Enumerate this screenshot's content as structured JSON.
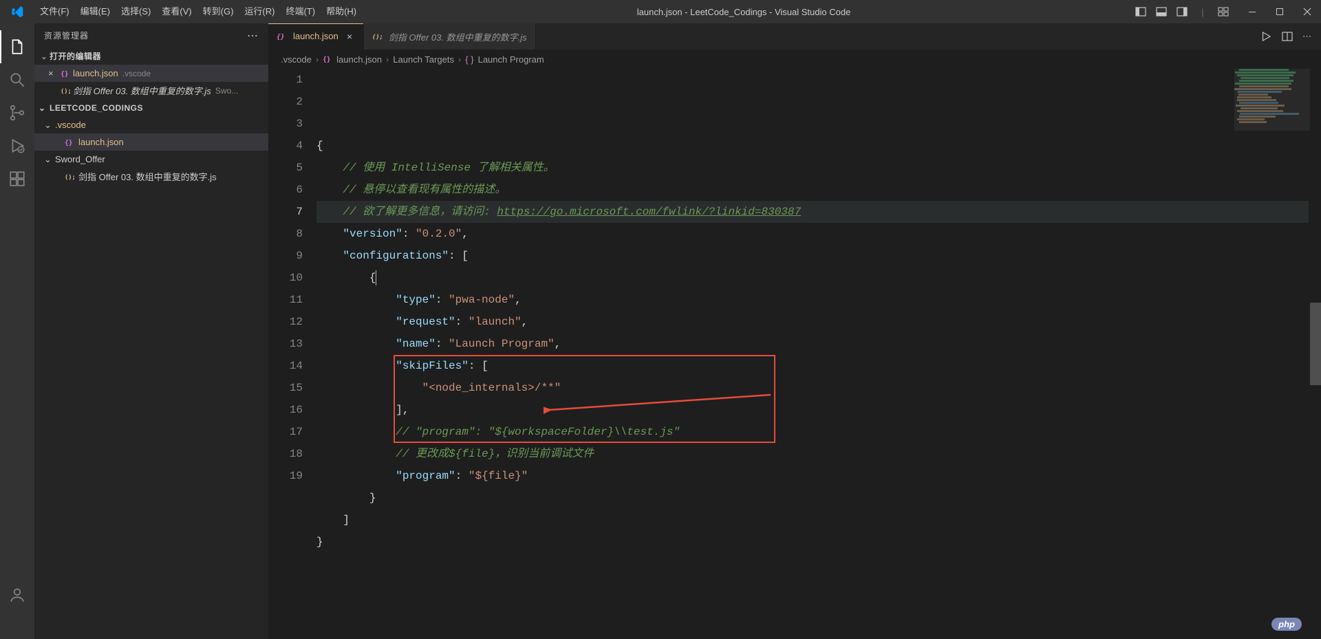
{
  "window": {
    "title": "launch.json - LeetCode_Codings - Visual Studio Code"
  },
  "menu": [
    "文件(F)",
    "编辑(E)",
    "选择(S)",
    "查看(V)",
    "转到(G)",
    "运行(R)",
    "终端(T)",
    "帮助(H)"
  ],
  "sidebar": {
    "title": "资源管理器",
    "open_editors_hdr": "打开的编辑器",
    "open_editors": [
      {
        "name": "launch.json",
        "dir": ".vscode",
        "modified": true
      },
      {
        "name": "剑指 Offer 03. 数组中重复的数字.js",
        "dir": "Swo...",
        "modified": false
      }
    ],
    "workspace": "LEETCODE_CODINGS",
    "tree": [
      {
        "type": "folder",
        "name": ".vscode",
        "depth": 1,
        "open": true
      },
      {
        "type": "file",
        "name": "launch.json",
        "depth": 2,
        "selected": true,
        "mod": true,
        "icon": "json"
      },
      {
        "type": "folder",
        "name": "Sword_Offer",
        "depth": 1,
        "open": true
      },
      {
        "type": "file",
        "name": "剑指 Offer 03. 数组中重复的数字.js",
        "depth": 2,
        "icon": "js"
      }
    ]
  },
  "tabs": [
    {
      "name": "launch.json",
      "active": true,
      "icon": "json",
      "mod": true
    },
    {
      "name": "剑指 Offer 03. 数组中重复的数字.js",
      "active": false,
      "icon": "js"
    }
  ],
  "breadcrumbs": [
    ".vscode",
    "launch.json",
    "Launch Targets",
    "Launch Program"
  ],
  "code": {
    "lines": [
      "{",
      "    // 使用 IntelliSense 了解相关属性。",
      "    // 悬停以查看现有属性的描述。",
      "    // 欲了解更多信息，请访问: https://go.microsoft.com/fwlink/?linkid=830387",
      "    \"version\": \"0.2.0\",",
      "    \"configurations\": [",
      "        {",
      "            \"type\": \"pwa-node\",",
      "            \"request\": \"launch\",",
      "            \"name\": \"Launch Program\",",
      "            \"skipFiles\": [",
      "                \"<node_internals>/**\"",
      "            ],",
      "            // \"program\": \"${workspaceFolder}\\\\test.js\"",
      "            // 更改成${file}，识别当前调试文件",
      "            \"program\": \"${file}\"",
      "        }",
      "    ]",
      "}"
    ],
    "active_line": 7
  },
  "badge": "php"
}
